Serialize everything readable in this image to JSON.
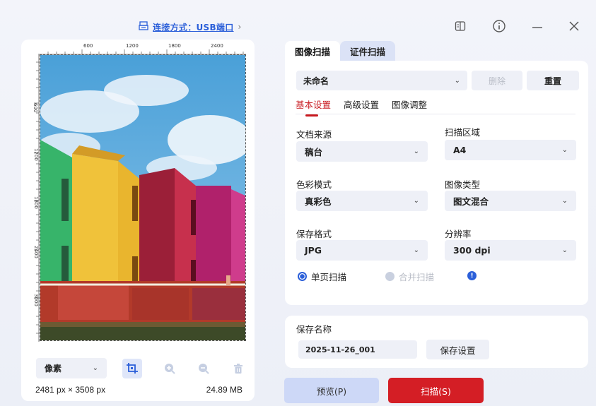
{
  "header": {
    "connection_label": "连接方式：USB端口",
    "connection_chevron": "›",
    "icons": [
      "printer-icon",
      "book-icon",
      "info-icon",
      "minimize-icon",
      "close-icon"
    ]
  },
  "preview": {
    "ruler_top_ticks": [
      "600",
      "1200",
      "1800",
      "2400"
    ],
    "ruler_left_ticks": [
      "600",
      "1200",
      "1800",
      "2400",
      "3000"
    ],
    "unit_select": "像素",
    "dimensions": "2481 px × 3508 px",
    "file_size": "24.89 MB"
  },
  "tabs": [
    {
      "label": "图像扫描",
      "active": true
    },
    {
      "label": "证件扫描",
      "active": false
    }
  ],
  "profile": {
    "selected": "未命名",
    "delete_label": "删除",
    "reset_label": "重置"
  },
  "subtabs": [
    {
      "label": "基本设置",
      "active": true
    },
    {
      "label": "高级设置",
      "active": false
    },
    {
      "label": "图像调整",
      "active": false
    }
  ],
  "fields": {
    "doc_source": {
      "label": "文档来源",
      "value": "稿台"
    },
    "scan_area": {
      "label": "扫描区域",
      "value": "A4"
    },
    "color_mode": {
      "label": "色彩模式",
      "value": "真彩色"
    },
    "image_type": {
      "label": "图像类型",
      "value": "图文混合"
    },
    "save_format": {
      "label": "保存格式",
      "value": "JPG"
    },
    "resolution": {
      "label": "分辨率",
      "value": "300 dpi"
    }
  },
  "scan_mode": {
    "single": "单页扫描",
    "merge": "合并扫描",
    "info_glyph": "!"
  },
  "save": {
    "name_label": "保存名称",
    "name_value": "2025-11-26_001",
    "settings_label": "保存设置"
  },
  "actions": {
    "preview_label": "预览(P)",
    "scan_label": "扫描(S)"
  },
  "colors": {
    "accent_red": "#d41e25",
    "accent_blue": "#2b5fd9",
    "preview_button": "#cdd8f7"
  }
}
